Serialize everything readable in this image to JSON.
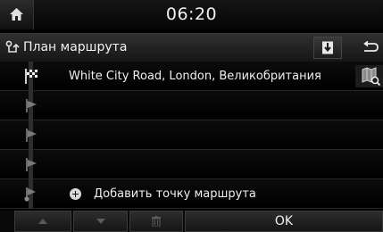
{
  "status_bar": {
    "time": "06:20",
    "home_icon": "home-icon"
  },
  "header": {
    "title": "План маршрута",
    "title_icon": "route-plan-icon",
    "save_icon": "download-icon",
    "back_icon": "back-arrow-icon"
  },
  "route": {
    "rows": [
      {
        "type": "destination",
        "icon": "checkered-flag-icon",
        "label": "White City Road, London, Великобритания",
        "action_icon": "map-search-icon"
      },
      {
        "type": "empty-waypoint",
        "icon": "flag-icon",
        "label": ""
      },
      {
        "type": "empty-waypoint",
        "icon": "flag-icon",
        "label": ""
      },
      {
        "type": "empty-waypoint",
        "icon": "flag-icon",
        "label": ""
      },
      {
        "type": "add",
        "icon": "start-marker-icon",
        "label": "Добавить точку маршрута"
      }
    ]
  },
  "toolbar": {
    "up_icon": "arrow-up-icon",
    "down_icon": "arrow-down-icon",
    "delete_icon": "trash-icon",
    "ok_label": "OK"
  },
  "colors": {
    "background": "#000000",
    "bar": "#2a2a2a",
    "text": "#f0f0f0",
    "disabled": "#5a5a5a"
  }
}
